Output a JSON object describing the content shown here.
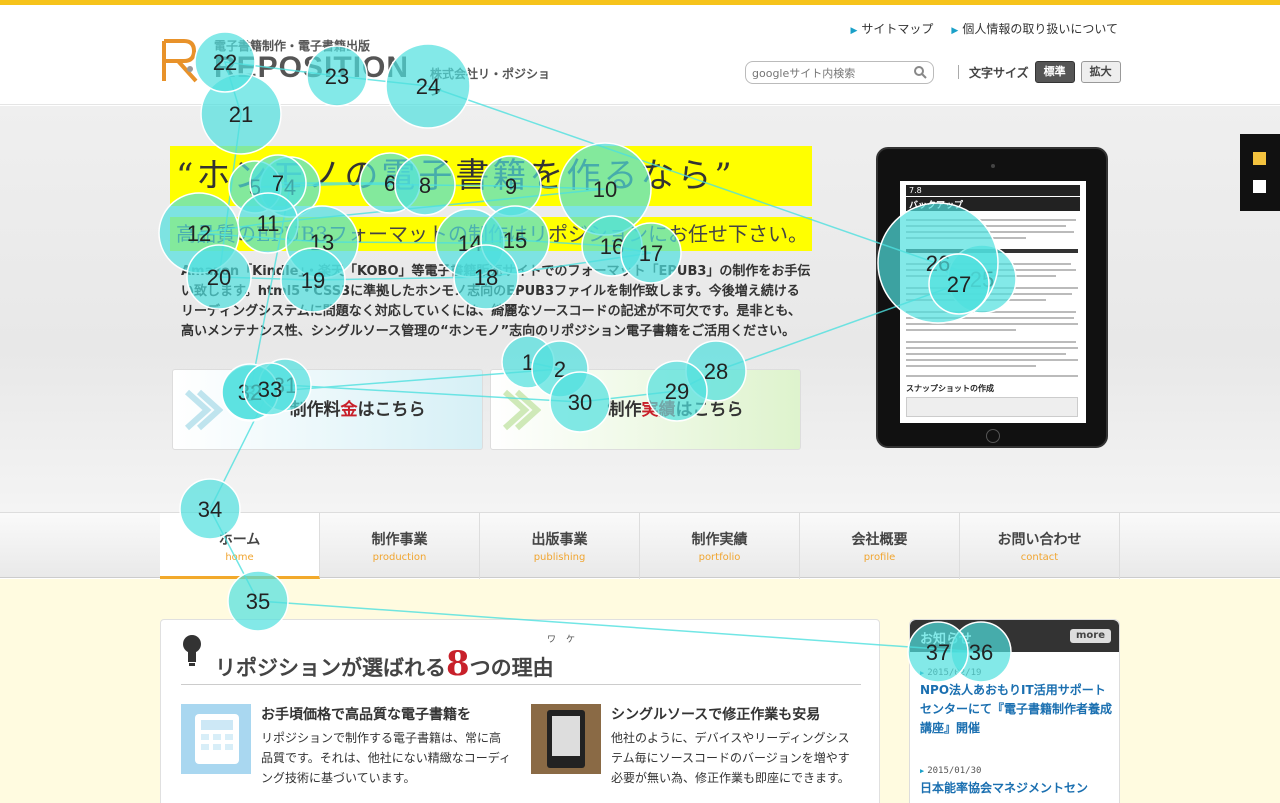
{
  "header": {
    "logo_tagline": "電子書籍制作・電子書籍出版",
    "logo_word": "REPOSITION",
    "logo_corp": "株式会社リ・ポジション",
    "top_links": [
      "サイトマップ",
      "個人情報の取り扱いについて"
    ],
    "search_placeholder": "googleサイト内検索",
    "fontsize_label": "文字サイズ",
    "fontsize_standard": "標準",
    "fontsize_large": "拡大"
  },
  "hero": {
    "headline": "“ホンモノの電子書籍を作るなら”",
    "subline": "高品質のEPUB3フォーマットの制作はリポジションにお任せ下さい。",
    "lead": "Amazon「Kindle」・楽天「KOBO」等電子書籍販売サイトでのフォーマット「EPUB3」の制作をお手伝い致します。html5・CSS3に準拠したホンモノ志向のEPUB3ファイルを制作致します。今後増え続けるリーディングシステムに問題なく対応していくには、綺麗なソースコードの記述が不可欠です。是非とも、高いメンテナンス性、シングルソース管理の“ホンモノ”志向のリポジション電子書籍をご活用ください。",
    "cta_price_pre": "制作料",
    "cta_price_em": "金",
    "cta_price_post": "はこちら",
    "cta_works_pre": "制作",
    "cta_works_em": "実績",
    "cta_works_post": "はこちら",
    "tablet_chapter": "7.8",
    "tablet_title": "バックアップ",
    "tablet_sub": "スナップショットの作成"
  },
  "nav": [
    {
      "jp": "ホーム",
      "en": "home"
    },
    {
      "jp": "制作事業",
      "en": "production"
    },
    {
      "jp": "出版事業",
      "en": "publishing"
    },
    {
      "jp": "制作実績",
      "en": "portfolio"
    },
    {
      "jp": "会社概要",
      "en": "profile"
    },
    {
      "jp": "お問い合わせ",
      "en": "contact"
    }
  ],
  "reasons": {
    "title_pre": "リポジションが選ばれる",
    "title_num": "8",
    "title_post": "つの理由",
    "furigana": "ワケ",
    "items": [
      {
        "head": "お手頃価格で高品質な電子書籍を",
        "body": "リポジションで制作する電子書籍は、常に高品質です。それは、他社にない精緻なコーディング技術に基づいています。"
      },
      {
        "head": "シングルソースで修正作業も安易",
        "body": "他社のように、デバイスやリーディングシステム毎にソースコードのバージョンを増やす必要が無い為、修正作業も即座にできます。"
      }
    ]
  },
  "news": {
    "title": "お知らせ",
    "more": "more",
    "items": [
      {
        "date": "2015/02/19",
        "text": "NPO法人あおもりIT活用サポートセンターにて『電子書籍制作者養成講座』開催"
      },
      {
        "date": "2015/01/30",
        "text": "日本能率協会マネジメントセン"
      }
    ]
  },
  "gaze_points": [
    {
      "n": "1"
    },
    {
      "n": "2"
    },
    {
      "n": "3"
    },
    {
      "n": "4"
    },
    {
      "n": "5"
    },
    {
      "n": "6"
    },
    {
      "n": "7"
    },
    {
      "n": "8"
    },
    {
      "n": "9"
    },
    {
      "n": "10"
    },
    {
      "n": "11"
    },
    {
      "n": "12"
    },
    {
      "n": "13"
    },
    {
      "n": "14"
    },
    {
      "n": "15"
    },
    {
      "n": "16"
    },
    {
      "n": "17"
    },
    {
      "n": "18"
    },
    {
      "n": "19"
    },
    {
      "n": "20"
    },
    {
      "n": "21"
    },
    {
      "n": "22"
    },
    {
      "n": "23"
    },
    {
      "n": "24"
    },
    {
      "n": "25"
    },
    {
      "n": "26"
    },
    {
      "n": "27"
    },
    {
      "n": "28"
    },
    {
      "n": "29"
    },
    {
      "n": "30"
    },
    {
      "n": "31"
    },
    {
      "n": "32"
    },
    {
      "n": "33"
    },
    {
      "n": "34"
    },
    {
      "n": "35"
    },
    {
      "n": "36"
    },
    {
      "n": "37"
    }
  ],
  "colors": {
    "accent": "#f6c31b",
    "highlight": "#ffff00",
    "gaze": "#4ee0de",
    "link": "#1a6fb0"
  }
}
